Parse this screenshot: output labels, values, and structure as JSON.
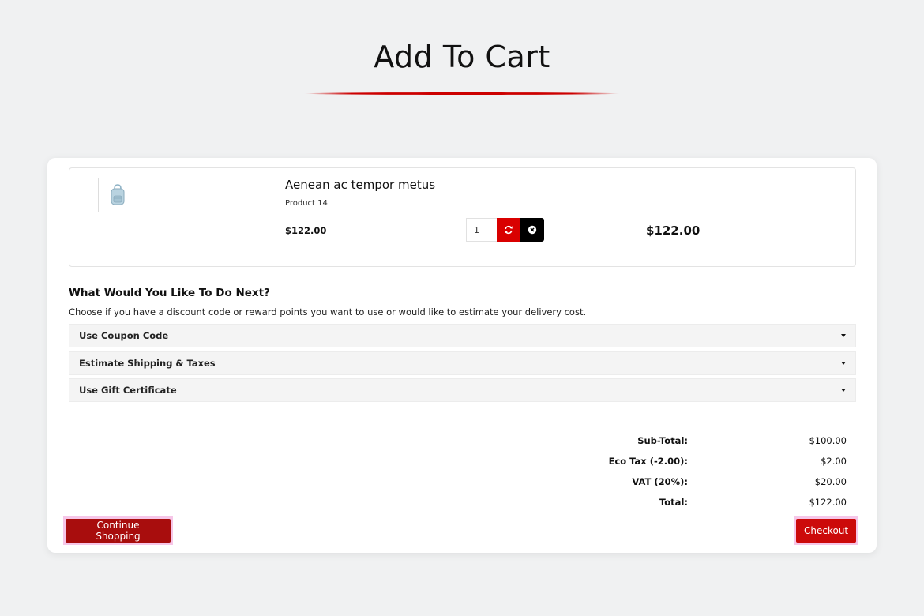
{
  "page": {
    "title": "Add To Cart"
  },
  "cart": {
    "item": {
      "name": "Aenean ac tempor metus",
      "model": "Product 14",
      "unit_price": "$122.00",
      "quantity": "1",
      "total": "$122.00",
      "image_icon": "backpack-icon"
    },
    "actions": {
      "refresh_icon": "refresh-icon",
      "remove_icon": "close-circle-icon"
    }
  },
  "next": {
    "heading": "What Would You Like To Do Next?",
    "description": "Choose if you have a discount code or reward points you want to use or would like to estimate your delivery cost.",
    "sections": [
      {
        "label": "Use Coupon Code"
      },
      {
        "label": "Estimate Shipping & Taxes"
      },
      {
        "label": "Use Gift Certificate"
      }
    ]
  },
  "totals": [
    {
      "label": "Sub-Total:",
      "value": "$100.00"
    },
    {
      "label": "Eco Tax (-2.00):",
      "value": "$2.00"
    },
    {
      "label": "VAT (20%):",
      "value": "$20.00"
    },
    {
      "label": "Total:",
      "value": "$122.00"
    }
  ],
  "buttons": {
    "continue": "Continue Shopping",
    "checkout": "Checkout"
  },
  "colors": {
    "accent": "#cc0a0a",
    "dark_accent": "#a80d0d",
    "black": "#000000"
  }
}
